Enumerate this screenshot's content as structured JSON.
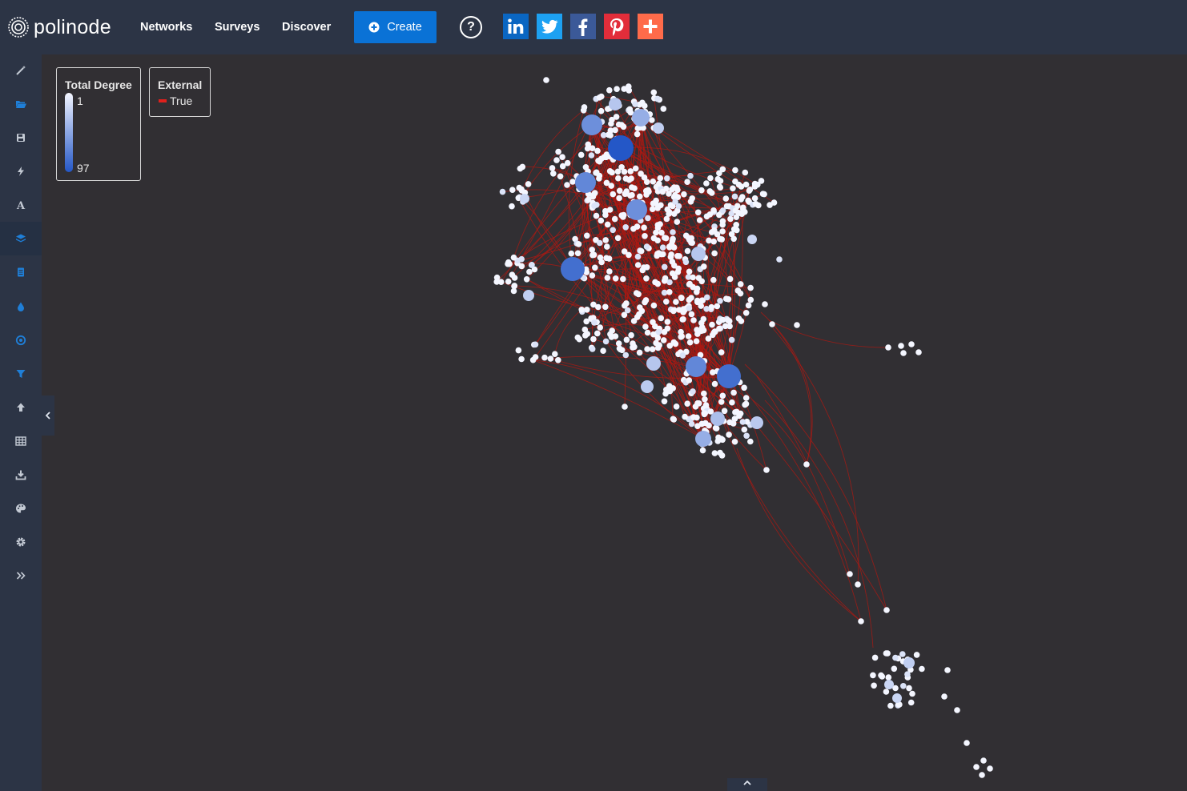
{
  "brand": {
    "logo_text": "polinode"
  },
  "nav": {
    "networks": "Networks",
    "surveys": "Surveys",
    "discover": "Discover"
  },
  "create_button": {
    "label": "Create"
  },
  "help_button": {
    "label": "?"
  },
  "social": [
    {
      "name": "linkedin-icon",
      "glyph": "in",
      "color": "#0a66c2"
    },
    {
      "name": "twitter-icon",
      "glyph": "",
      "color": "#1da1f2"
    },
    {
      "name": "facebook-icon",
      "glyph": "f",
      "color": "#3b5998"
    },
    {
      "name": "pinterest-icon",
      "glyph": "P",
      "color": "#e22d3a"
    },
    {
      "name": "addthis-icon",
      "glyph": "+",
      "color": "#ff6b4a"
    }
  ],
  "sidebar": {
    "items": [
      {
        "name": "magic-wand-icon",
        "active": false
      },
      {
        "name": "folder-open-icon",
        "active": false
      },
      {
        "name": "save-icon",
        "active": false
      },
      {
        "name": "bolt-icon",
        "active": false
      },
      {
        "name": "font-icon",
        "active": false
      },
      {
        "name": "layers-icon",
        "active": true
      },
      {
        "name": "document-icon",
        "active": false
      },
      {
        "name": "drop-icon",
        "active": false
      },
      {
        "name": "target-icon",
        "active": false
      },
      {
        "name": "filter-icon",
        "active": false
      },
      {
        "name": "upload-icon",
        "active": false
      },
      {
        "name": "table-icon",
        "active": false
      },
      {
        "name": "download-icon",
        "active": false
      },
      {
        "name": "palette-icon",
        "active": false
      },
      {
        "name": "settings-icon",
        "active": false
      },
      {
        "name": "expand-icon",
        "active": false
      }
    ]
  },
  "legend": {
    "degree": {
      "title": "Total Degree",
      "min": "1",
      "max": "97",
      "color_low": "#f4f6ff",
      "color_high": "#2457c7"
    },
    "external": {
      "title": "External",
      "item": "True",
      "color": "#e0201c"
    }
  },
  "colors": {
    "background": "#312f33",
    "topbar": "#2c3445",
    "edge": "#b01812",
    "node": "#ffffff"
  }
}
